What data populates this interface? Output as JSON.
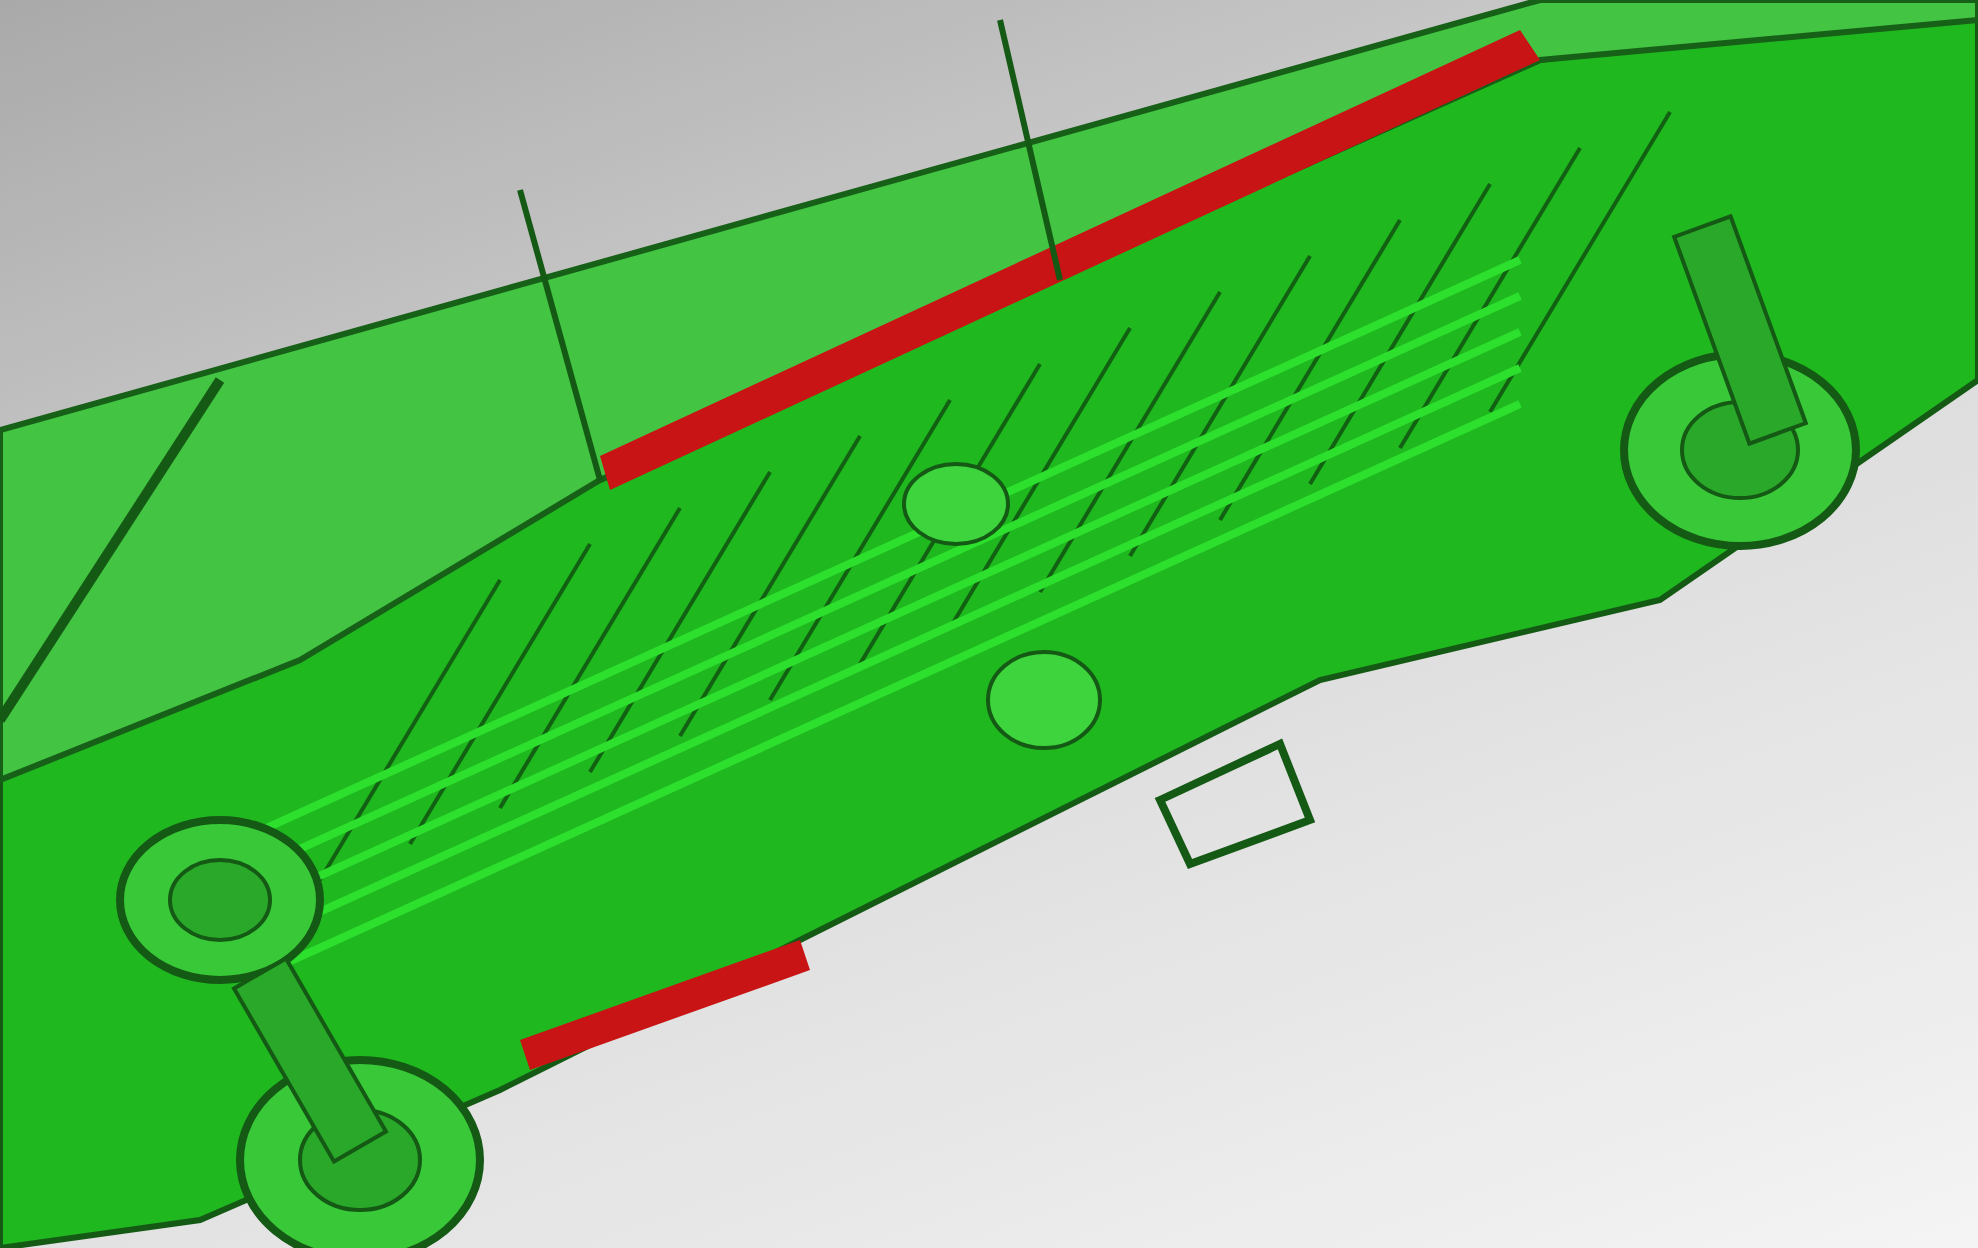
{
  "viewport": {
    "kind": "cad-model"
  }
}
